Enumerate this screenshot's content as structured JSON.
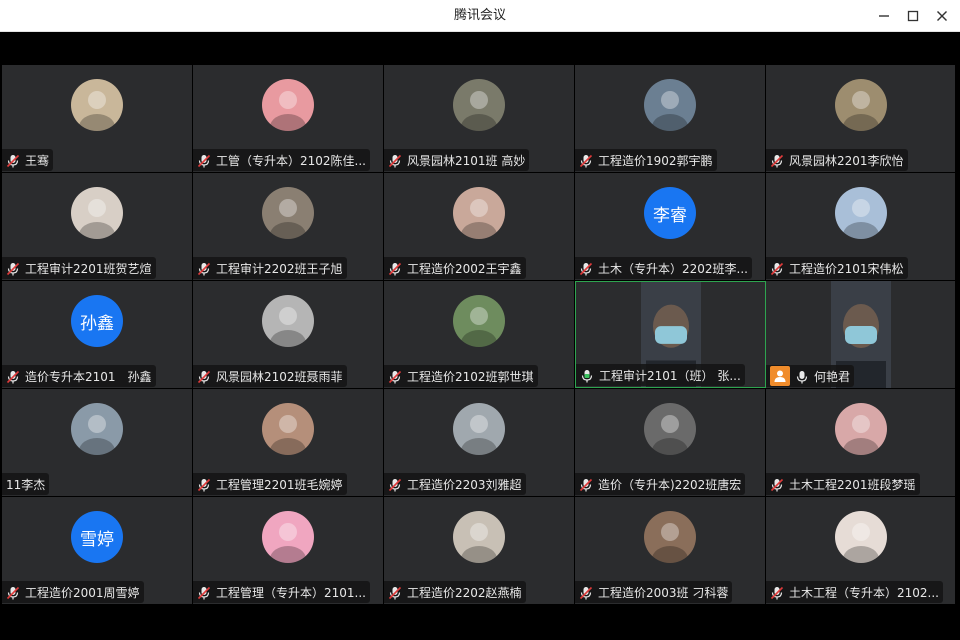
{
  "window": {
    "title": "腾讯会议"
  },
  "participants": [
    {
      "name": "王骞",
      "avatar_color": "#c9b79a",
      "mic": "muted"
    },
    {
      "name": "工管（专升本）2102陈佳...",
      "avatar_color": "#e89aa0",
      "mic": "muted"
    },
    {
      "name": "风景园林2101班 高妙",
      "avatar_color": "#7a7a6a",
      "mic": "muted"
    },
    {
      "name": "工程造价1902郭宇鹏",
      "avatar_color": "#6b7f92",
      "mic": "muted"
    },
    {
      "name": "风景园林2201李欣怡",
      "avatar_color": "#9d8d6f",
      "mic": "muted"
    },
    {
      "name": "工程审计2201班贺艺煊",
      "avatar_color": "#d8cfc6",
      "mic": "muted"
    },
    {
      "name": "工程审计2202班王子旭",
      "avatar_color": "#8a7f72",
      "mic": "muted"
    },
    {
      "name": "工程造价2002王宇鑫",
      "avatar_color": "#c9a89a",
      "mic": "muted"
    },
    {
      "name": "土木（专升本）2202班李...",
      "avatar_text": "李睿",
      "mic": "muted"
    },
    {
      "name": "工程造价2101宋伟松",
      "avatar_color": "#a9bfd8",
      "mic": "muted"
    },
    {
      "name": "造价专升本2101　孙鑫",
      "avatar_text": "孙鑫",
      "mic": "muted"
    },
    {
      "name": "风景园林2102班聂雨菲",
      "avatar_color": "#b5b5b5",
      "mic": "muted"
    },
    {
      "name": "工程造价2102班郭世琪",
      "avatar_color": "#6e8c5e",
      "mic": "muted"
    },
    {
      "name": "工程审计2101（班） 张...",
      "video": true,
      "mic": "speaking",
      "active": true
    },
    {
      "name": "何艳君",
      "video": true,
      "mic": "on",
      "badge": "person"
    },
    {
      "name": "11李杰",
      "avatar_color": "#8a9aa8",
      "mic": "none"
    },
    {
      "name": "工程管理2201班毛婉婷",
      "avatar_color": "#b58f7a",
      "mic": "muted"
    },
    {
      "name": "工程造价2203刘雅超",
      "avatar_color": "#a0a8ae",
      "mic": "muted"
    },
    {
      "name": "造价（专升本)2202班唐宏",
      "avatar_color": "#6a6a6a",
      "mic": "muted"
    },
    {
      "name": "土木工程2201班段梦瑶",
      "avatar_color": "#d8a8a8",
      "mic": "muted"
    },
    {
      "name": "工程造价2001周雪婷",
      "avatar_text": "雪婷",
      "mic": "muted"
    },
    {
      "name": "工程管理（专升本）2101...",
      "avatar_color": "#f0a6c0",
      "mic": "muted"
    },
    {
      "name": "工程造价2202赵燕楠",
      "avatar_color": "#c8c0b5",
      "mic": "muted"
    },
    {
      "name": "工程造价2003班 刁科蓉",
      "avatar_color": "#8a6e5a",
      "mic": "muted"
    },
    {
      "name": "土木工程（专升本）2102...",
      "avatar_color": "#e6dcd6",
      "mic": "muted"
    }
  ],
  "colors": {
    "tile_bg": "#2b2c2e",
    "avatar_blue": "#1976f2",
    "muted_red": "#e03b3b",
    "active_green": "#2ea44f"
  },
  "icons": {
    "minimize": "minimize-icon",
    "maximize": "maximize-icon",
    "close": "close-icon",
    "mic": "mic-icon"
  }
}
